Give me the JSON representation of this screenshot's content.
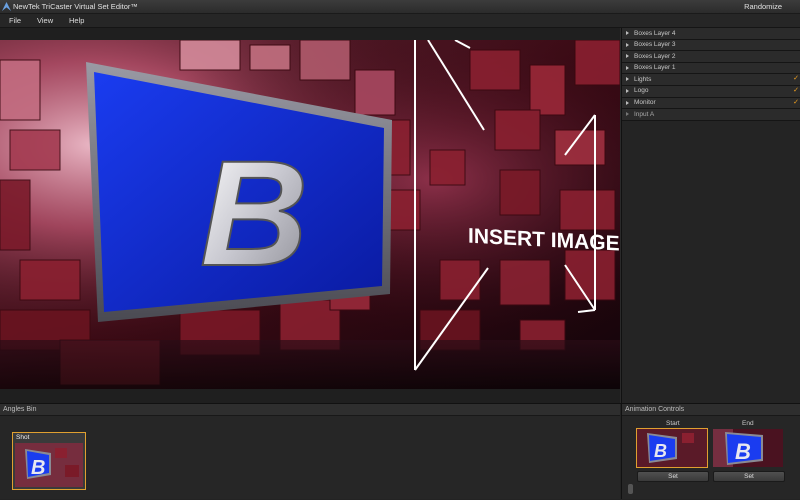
{
  "window": {
    "title": "NewTek TriCaster Virtual Set Editor™",
    "randomize_label": "Randomize"
  },
  "menu": {
    "items": [
      "File",
      "View",
      "Help"
    ]
  },
  "preview": {
    "monitor_letter": "B",
    "insert_text": "INSERT IMAGE"
  },
  "layers": [
    {
      "label": "Boxes Layer 4",
      "checked": false
    },
    {
      "label": "Boxes Layer 3",
      "checked": false
    },
    {
      "label": "Boxes Layer 2",
      "checked": false
    },
    {
      "label": "Boxes Layer 1",
      "checked": false
    },
    {
      "label": "Lights",
      "checked": true
    },
    {
      "label": "Logo",
      "checked": true
    },
    {
      "label": "Monitor",
      "checked": true
    },
    {
      "label": "Input A",
      "checked": false
    }
  ],
  "layer_check_glyph": "✓",
  "angles_bin": {
    "title": "Angles Bin",
    "shot_label": "Shot"
  },
  "animation": {
    "title": "Animation Controls",
    "start_label": "Start",
    "end_label": "End",
    "set_label": "Set"
  },
  "colors": {
    "accent": "#e0a030",
    "check": "#f0a020",
    "monitor_blue": "#0a2fd6"
  }
}
